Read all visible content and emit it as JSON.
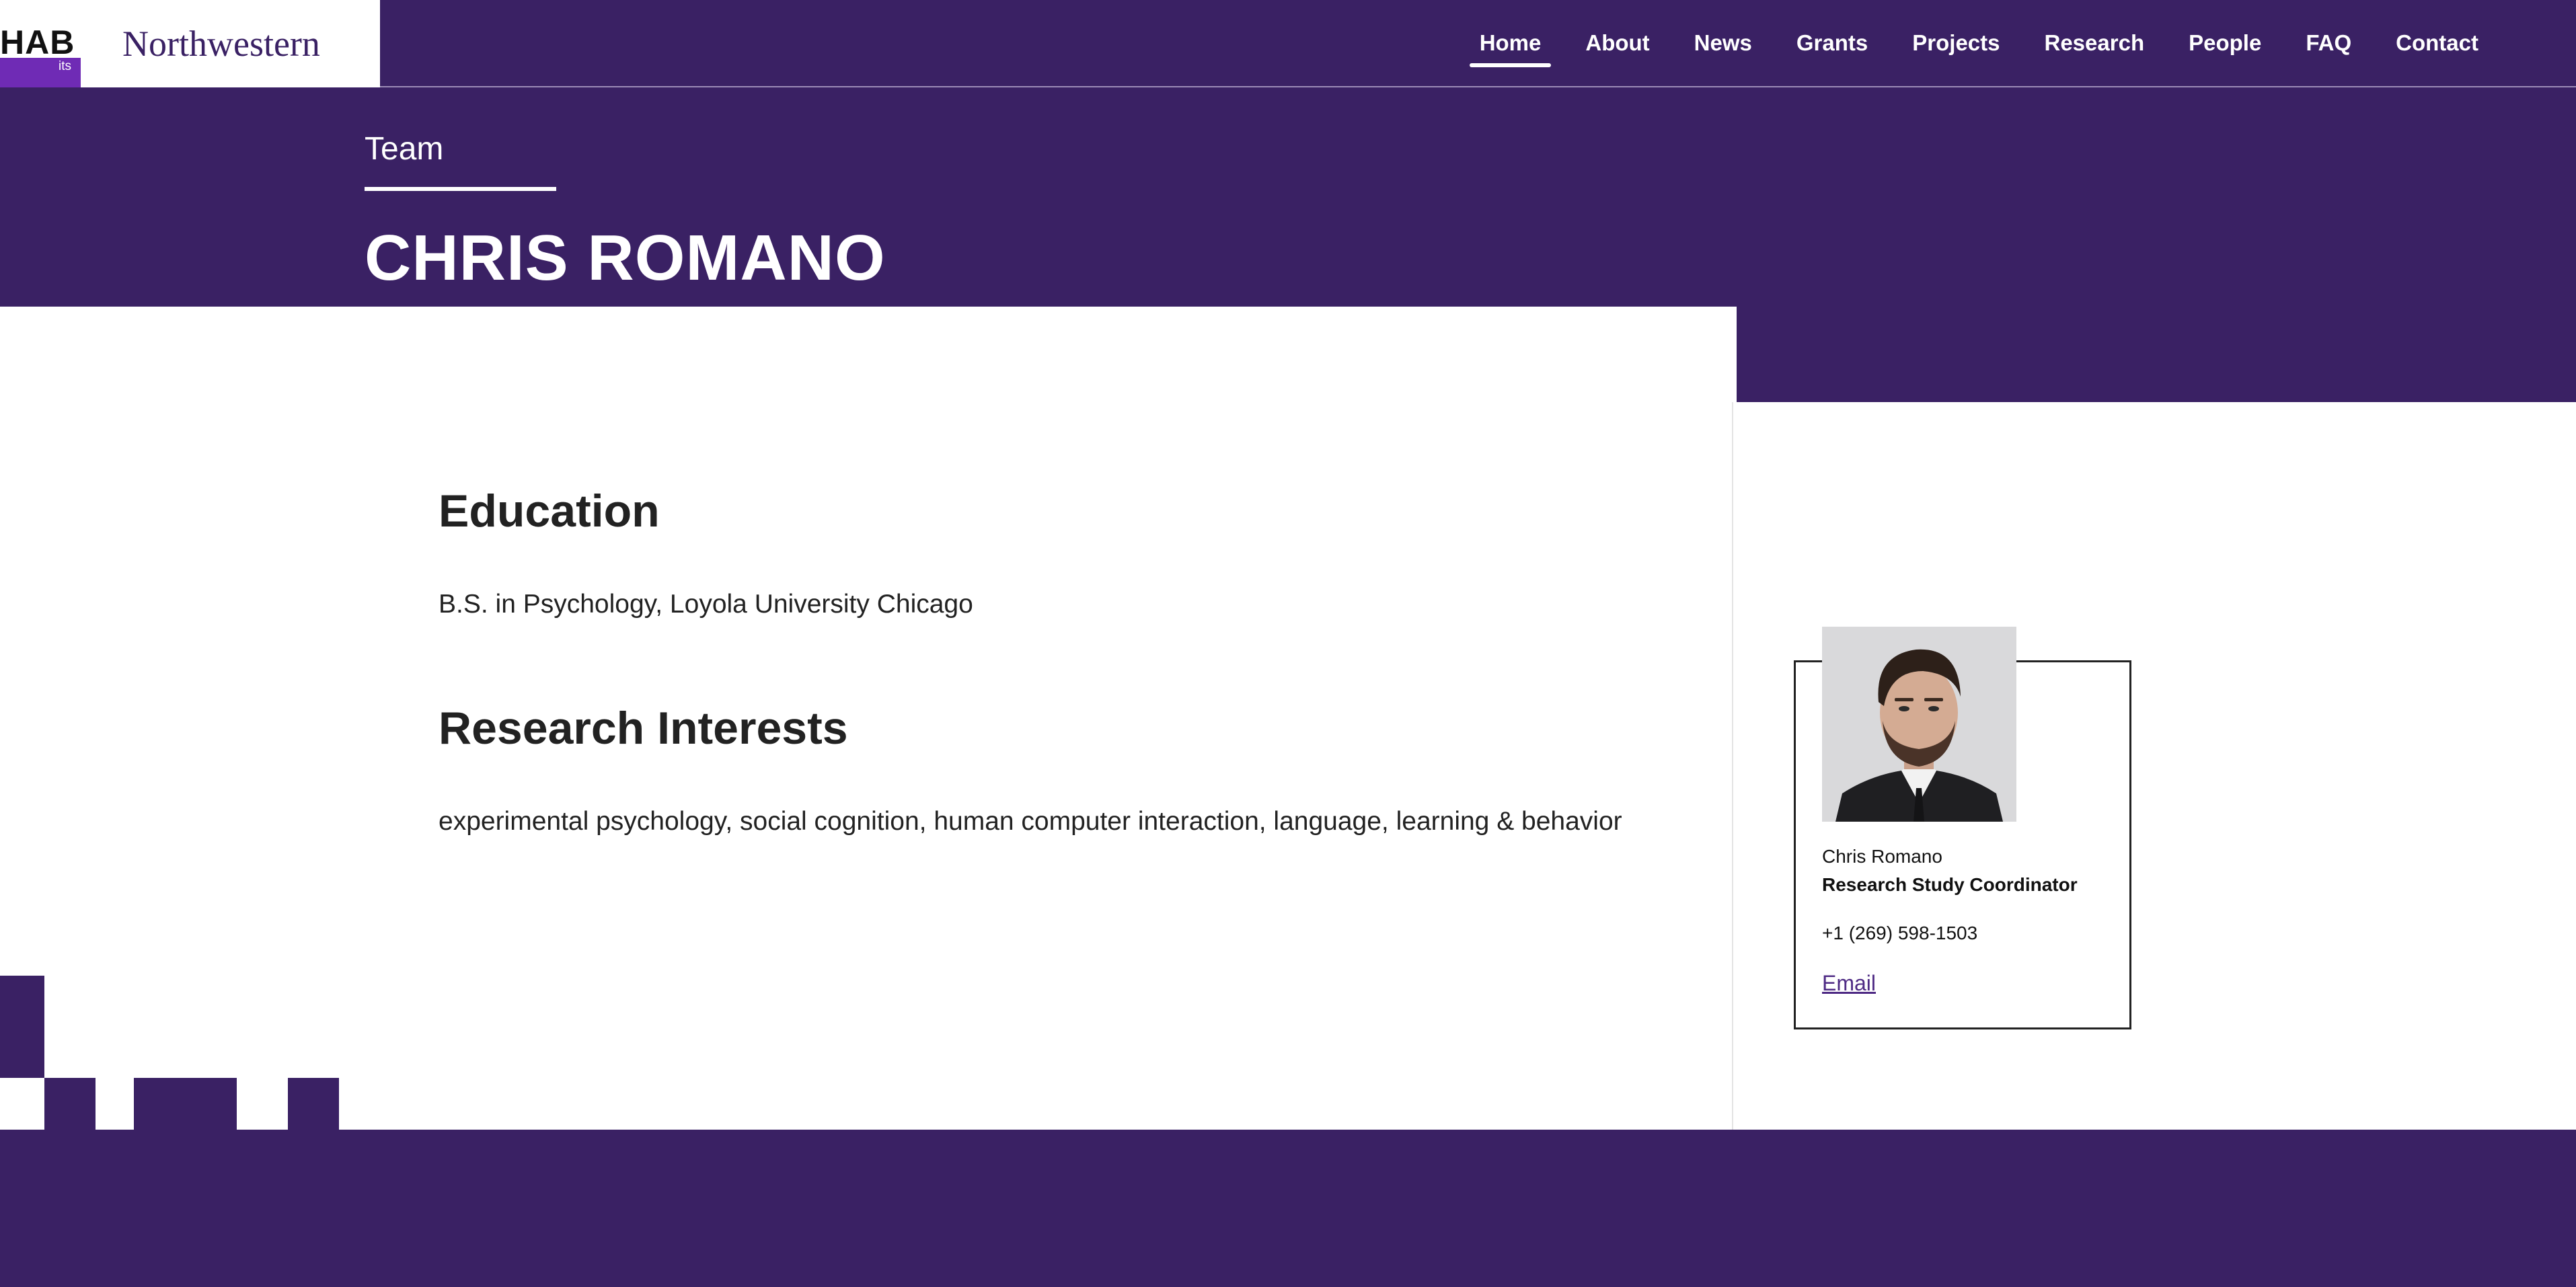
{
  "brand": {
    "lab_name": "HAB",
    "lab_sub": "its",
    "university": "Northwestern"
  },
  "nav": {
    "items": [
      {
        "label": "Home",
        "active": true
      },
      {
        "label": "About",
        "active": false
      },
      {
        "label": "News",
        "active": false
      },
      {
        "label": "Grants",
        "active": false
      },
      {
        "label": "Projects",
        "active": false
      },
      {
        "label": "Research",
        "active": false
      },
      {
        "label": "People",
        "active": false
      },
      {
        "label": "FAQ",
        "active": false
      },
      {
        "label": "Contact",
        "active": false
      }
    ]
  },
  "hero": {
    "breadcrumb": "Team",
    "title": "CHRIS ROMANO"
  },
  "main": {
    "education_heading": "Education",
    "education_text": "B.S. in Psychology, Loyola University Chicago",
    "interests_heading": "Research Interests",
    "interests_text": "experimental psychology, social cognition, human computer interaction, language, learning & behavior"
  },
  "profile": {
    "name": "Chris Romano",
    "role": "Research Study Coordinator",
    "phone": "+1 (269) 598-1503",
    "email_label": "Email"
  },
  "colors": {
    "brand_purple": "#3a2164",
    "accent_purple": "#6f2bb5",
    "link_purple": "#4e2a84"
  }
}
